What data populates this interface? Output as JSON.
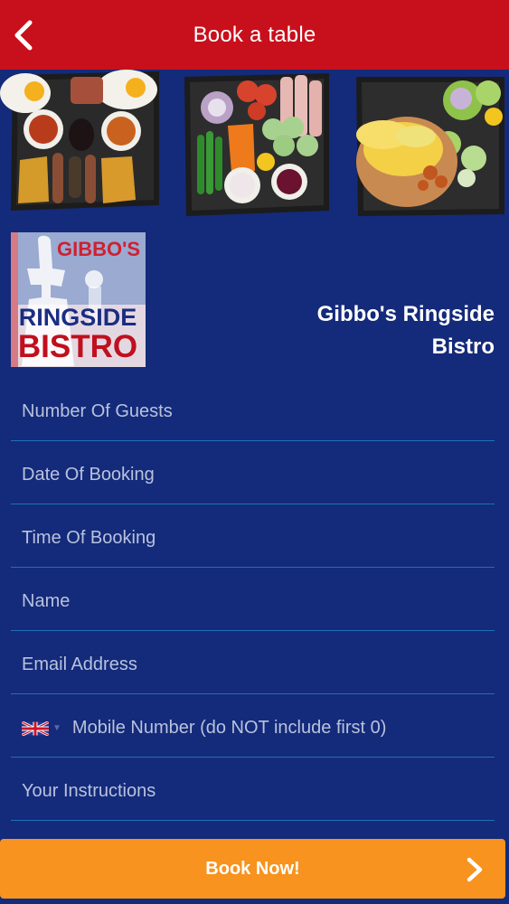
{
  "header": {
    "title": "Book a table",
    "back_icon": "chevron-left-icon",
    "background": "#c8101c"
  },
  "photos": [
    {
      "name": "breakfast-plate-photo"
    },
    {
      "name": "salad-plate-photo"
    },
    {
      "name": "jacket-potato-photo"
    }
  ],
  "logo": {
    "line1": "GIBBO'S",
    "line2": "RINGSIDE",
    "line3": "BISTRO"
  },
  "venue": {
    "name": "Gibbo's Ringside Bistro"
  },
  "form": {
    "guests_placeholder": "Number Of Guests",
    "date_placeholder": "Date Of Booking",
    "time_placeholder": "Time Of Booking",
    "name_placeholder": "Name",
    "email_placeholder": "Email Address",
    "mobile_placeholder": "Mobile Number (do NOT include first 0)",
    "instructions_placeholder": "Your Instructions",
    "country_flag": "uk-flag-icon"
  },
  "action": {
    "book_label": "Book Now!",
    "background": "#f7931e"
  },
  "theme": {
    "page_background": "#142a7a",
    "divider": "#1e71b8"
  }
}
